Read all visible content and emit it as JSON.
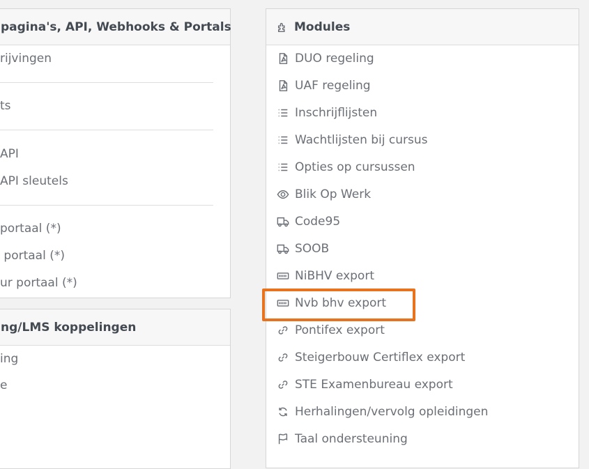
{
  "left_panel_top": {
    "title": "pagina's, API, Webhooks & Portals",
    "items": [
      {
        "label": "rijvingen"
      },
      {
        "label": "ts"
      },
      {
        "label": "API"
      },
      {
        "label": "API sleutels"
      },
      {
        "label": "portaal (*)"
      },
      {
        "label": " portaal (*)"
      },
      {
        "label": "ur portaal (*)"
      }
    ]
  },
  "left_panel_bottom": {
    "title": "ng/LMS koppelingen",
    "items": [
      {
        "label": "ing"
      },
      {
        "label": "e"
      }
    ]
  },
  "modules": {
    "title": "Modules",
    "title_icon": "puzzle-icon",
    "items": [
      {
        "label": "DUO regeling",
        "icon": "pdf-file-icon"
      },
      {
        "label": "UAF regeling",
        "icon": "pdf-file-icon"
      },
      {
        "label": "Inschrijflijsten",
        "icon": "list-icon"
      },
      {
        "label": "Wachtlijsten bij cursus",
        "icon": "list-icon"
      },
      {
        "label": "Opties op cursussen",
        "icon": "list-icon"
      },
      {
        "label": "Blik Op Werk",
        "icon": "eye-icon"
      },
      {
        "label": "Code95",
        "icon": "truck-icon"
      },
      {
        "label": "SOOB",
        "icon": "truck-icon"
      },
      {
        "label": "NiBHV export",
        "icon": "id-card-icon"
      },
      {
        "label": "Nvb bhv export",
        "icon": "id-card-icon"
      },
      {
        "label": "Pontifex export",
        "icon": "link-icon"
      },
      {
        "label": "Steigerbouw Certiflex export",
        "icon": "link-icon"
      },
      {
        "label": "STE Examenbureau export",
        "icon": "link-icon"
      },
      {
        "label": "Herhalingen/vervolg opleidingen",
        "icon": "refresh-icon"
      },
      {
        "label": "Taal ondersteuning",
        "icon": "flag-icon"
      }
    ]
  },
  "colors": {
    "highlight": "#e8731e",
    "text": "#6b6f76",
    "header_text": "#444a52"
  }
}
